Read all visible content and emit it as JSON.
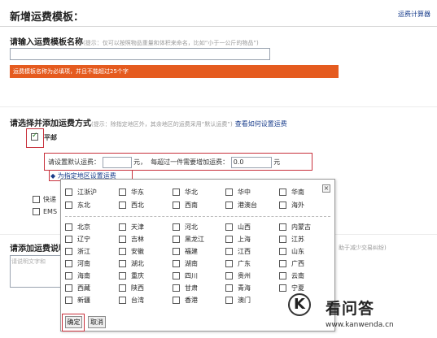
{
  "header": {
    "title": "新增运费模板：",
    "calc_link": "运费计算器"
  },
  "section1": {
    "label": "请输入运费模板名称",
    "hint": "(提示：仅可以按照物品重量和体积来命名，比如“小于一公斤的物品”)",
    "name_value": "",
    "error": "运费模板名称为必填项，并且不能超过25个字"
  },
  "section2": {
    "label": "请选择并添加运费方式",
    "hint": "(提示：除指定地区外，其余地区的运费采用“默认运费”)",
    "link": "查看如何设置运费",
    "method_label": "平邮",
    "method_checked": true,
    "default_fee_label": "请设置默认运费：",
    "unit1": "元，",
    "extra_label": "每超过一件需要增加运费：",
    "extra_value": "0.0",
    "unit2": "元",
    "add_region": "为指定地区设置运费",
    "other_methods": [
      "快递",
      "EMS"
    ]
  },
  "section3": {
    "label": "请添加运费说明",
    "placeholder": "请说明文字和",
    "hint": "助于减少交易纠纷)"
  },
  "popup": {
    "close": "×",
    "groups": [
      [
        "江浙沪",
        "华东",
        "华北",
        "华中",
        "华南"
      ],
      [
        "东北",
        "西北",
        "西南",
        "港澳台",
        "海外"
      ]
    ],
    "provinces": [
      [
        "北京",
        "天津",
        "河北",
        "山西",
        "内蒙古"
      ],
      [
        "辽宁",
        "吉林",
        "黑龙江",
        "上海",
        "江苏"
      ],
      [
        "浙江",
        "安徽",
        "福建",
        "江西",
        "山东"
      ],
      [
        "河南",
        "湖北",
        "湖南",
        "广东",
        "广西"
      ],
      [
        "海南",
        "重庆",
        "四川",
        "贵州",
        "云南"
      ],
      [
        "西藏",
        "陕西",
        "甘肃",
        "青海",
        "宁夏"
      ],
      [
        "新疆",
        "台湾",
        "香港",
        "澳门",
        ""
      ]
    ],
    "confirm": "确定",
    "cancel": "取消"
  },
  "watermark": {
    "name": "看问答",
    "url": "www.kanwenda.cn",
    "logo_letter": "K"
  },
  "colors": {
    "error_bar": "#e55b1f",
    "highlight_border": "#c8313c",
    "link": "#1a3e8c"
  }
}
